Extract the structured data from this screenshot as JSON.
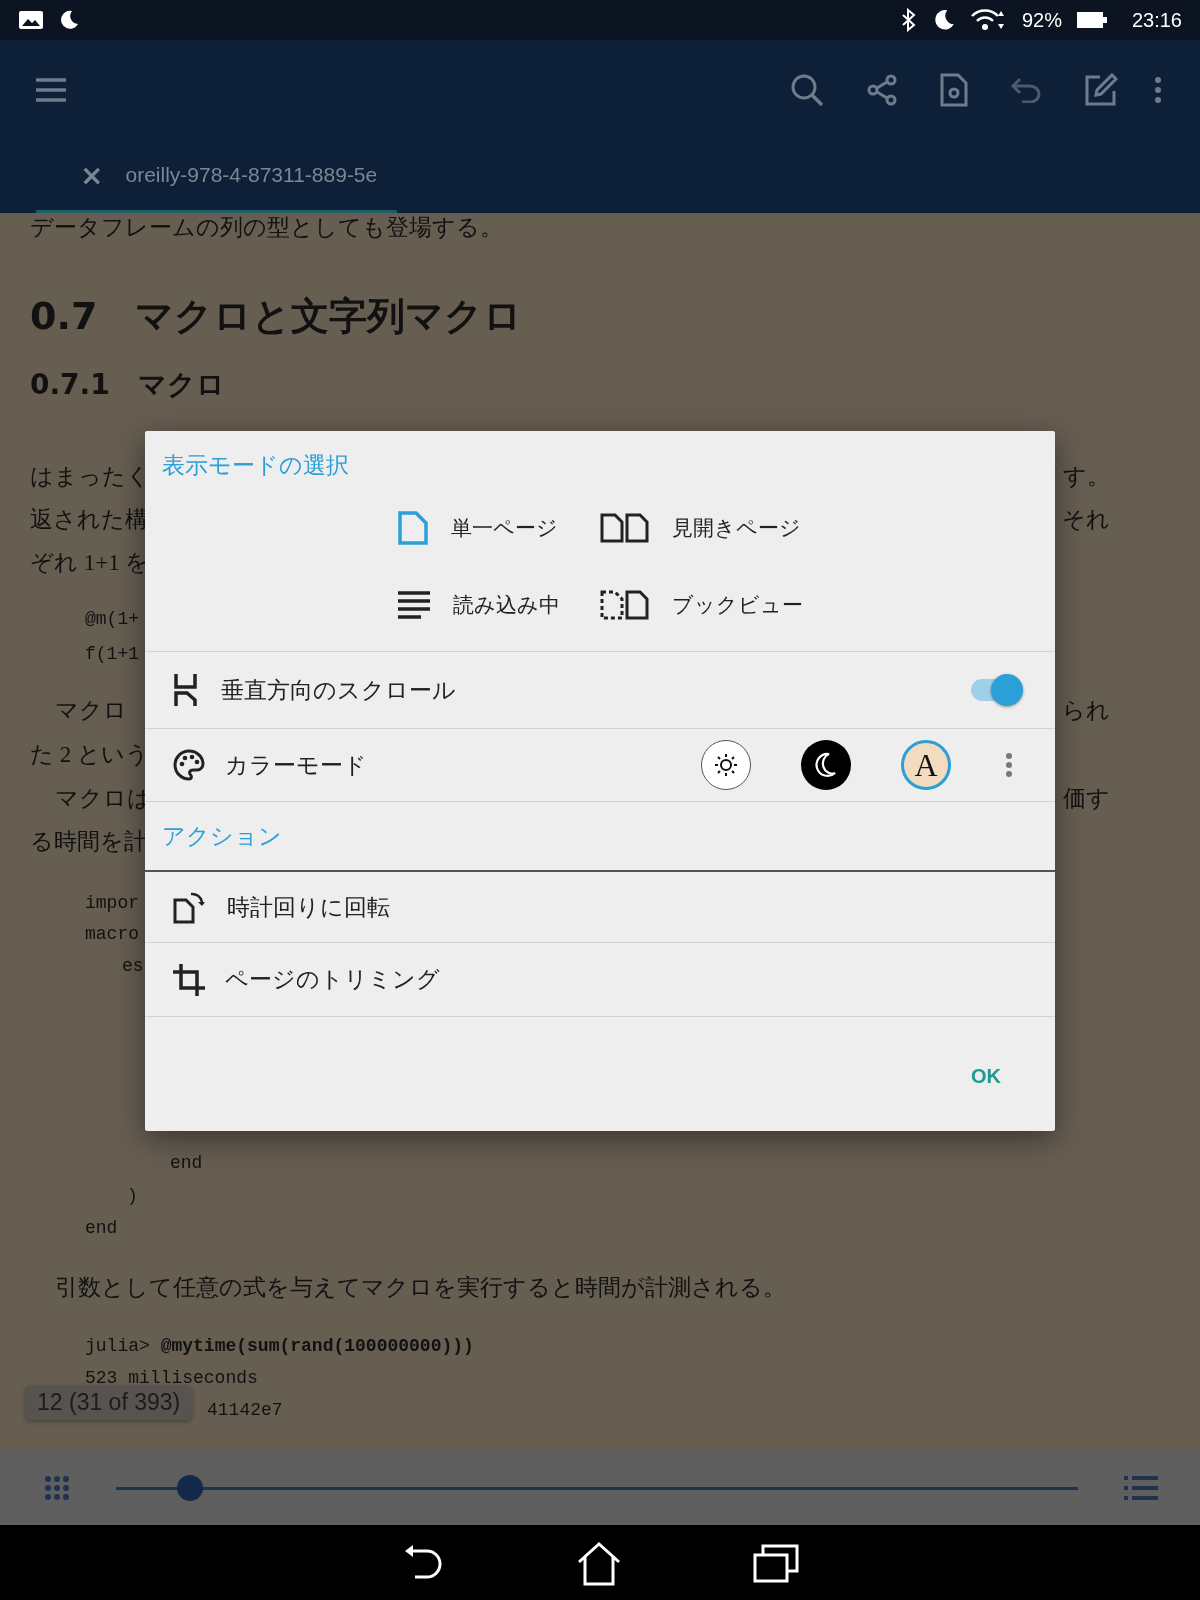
{
  "status_bar": {
    "battery": "92%",
    "time": "23:16"
  },
  "tab": {
    "close": "×",
    "title": "oreilly-978-4-87311-889-5e"
  },
  "document": {
    "lines": [
      {
        "kind": "body",
        "text": "データフレームの列の型としても登場する。"
      },
      {
        "kind": "heading",
        "text": "0.7　マクロと文字列マクロ"
      },
      {
        "kind": "subheading",
        "text": "0.7.1　マクロ"
      },
      {
        "kind": "body",
        "text": "はまったく",
        "right": "す。"
      },
      {
        "kind": "body",
        "text": "返された構",
        "right": "それ"
      },
      {
        "kind": "body",
        "text": "ぞれ 1+1 を"
      },
      {
        "kind": "code",
        "text": "@m(1+"
      },
      {
        "kind": "code",
        "text": "f(1+1"
      },
      {
        "kind": "body",
        "text": "マクロ",
        "right": "られ"
      },
      {
        "kind": "body",
        "text": "た 2 という"
      },
      {
        "kind": "body",
        "text": "マクロは",
        "right": "価す"
      },
      {
        "kind": "body",
        "text": "る時間を計"
      },
      {
        "kind": "code",
        "text": "impor"
      },
      {
        "kind": "code",
        "text": "macro"
      },
      {
        "kind": "code",
        "text": "es"
      },
      {
        "kind": "code",
        "text": "end"
      },
      {
        "kind": "code",
        "text": ")"
      },
      {
        "kind": "code",
        "text": "end"
      },
      {
        "kind": "body",
        "text": "引数として任意の式を与えてマクロを実行すると時間が計測される。"
      },
      {
        "kind": "code",
        "text": "julia> **@mytime(sum(rand(100000000)))**"
      },
      {
        "kind": "code",
        "text": "523 milliseconds"
      },
      {
        "kind": "code",
        "text": "41142e7"
      }
    ],
    "page_badge": "12 (31 of 393)"
  },
  "dialog": {
    "title": "表示モードの選択",
    "view_modes": [
      {
        "kind": "single",
        "label": "単一ページ",
        "selected": true
      },
      {
        "kind": "spread",
        "label": "見開きページ",
        "selected": false
      },
      {
        "kind": "reading",
        "label": "読み込み中",
        "selected": false
      },
      {
        "kind": "book",
        "label": "ブックビュー",
        "selected": false
      }
    ],
    "vertical_scroll": {
      "label": "垂直方向のスクロール",
      "on": true
    },
    "color_mode": {
      "label": "カラーモード",
      "options": [
        {
          "kind": "light",
          "selected": false
        },
        {
          "kind": "dark",
          "selected": false
        },
        {
          "kind": "sepia",
          "label": "A",
          "selected": true
        }
      ]
    },
    "actions_title": "アクション",
    "actions": [
      {
        "kind": "rotate",
        "label": "時計回りに回転"
      },
      {
        "kind": "crop",
        "label": "ページのトリミング"
      }
    ],
    "ok": "OK"
  },
  "page_slider": {
    "level": 0.077
  }
}
